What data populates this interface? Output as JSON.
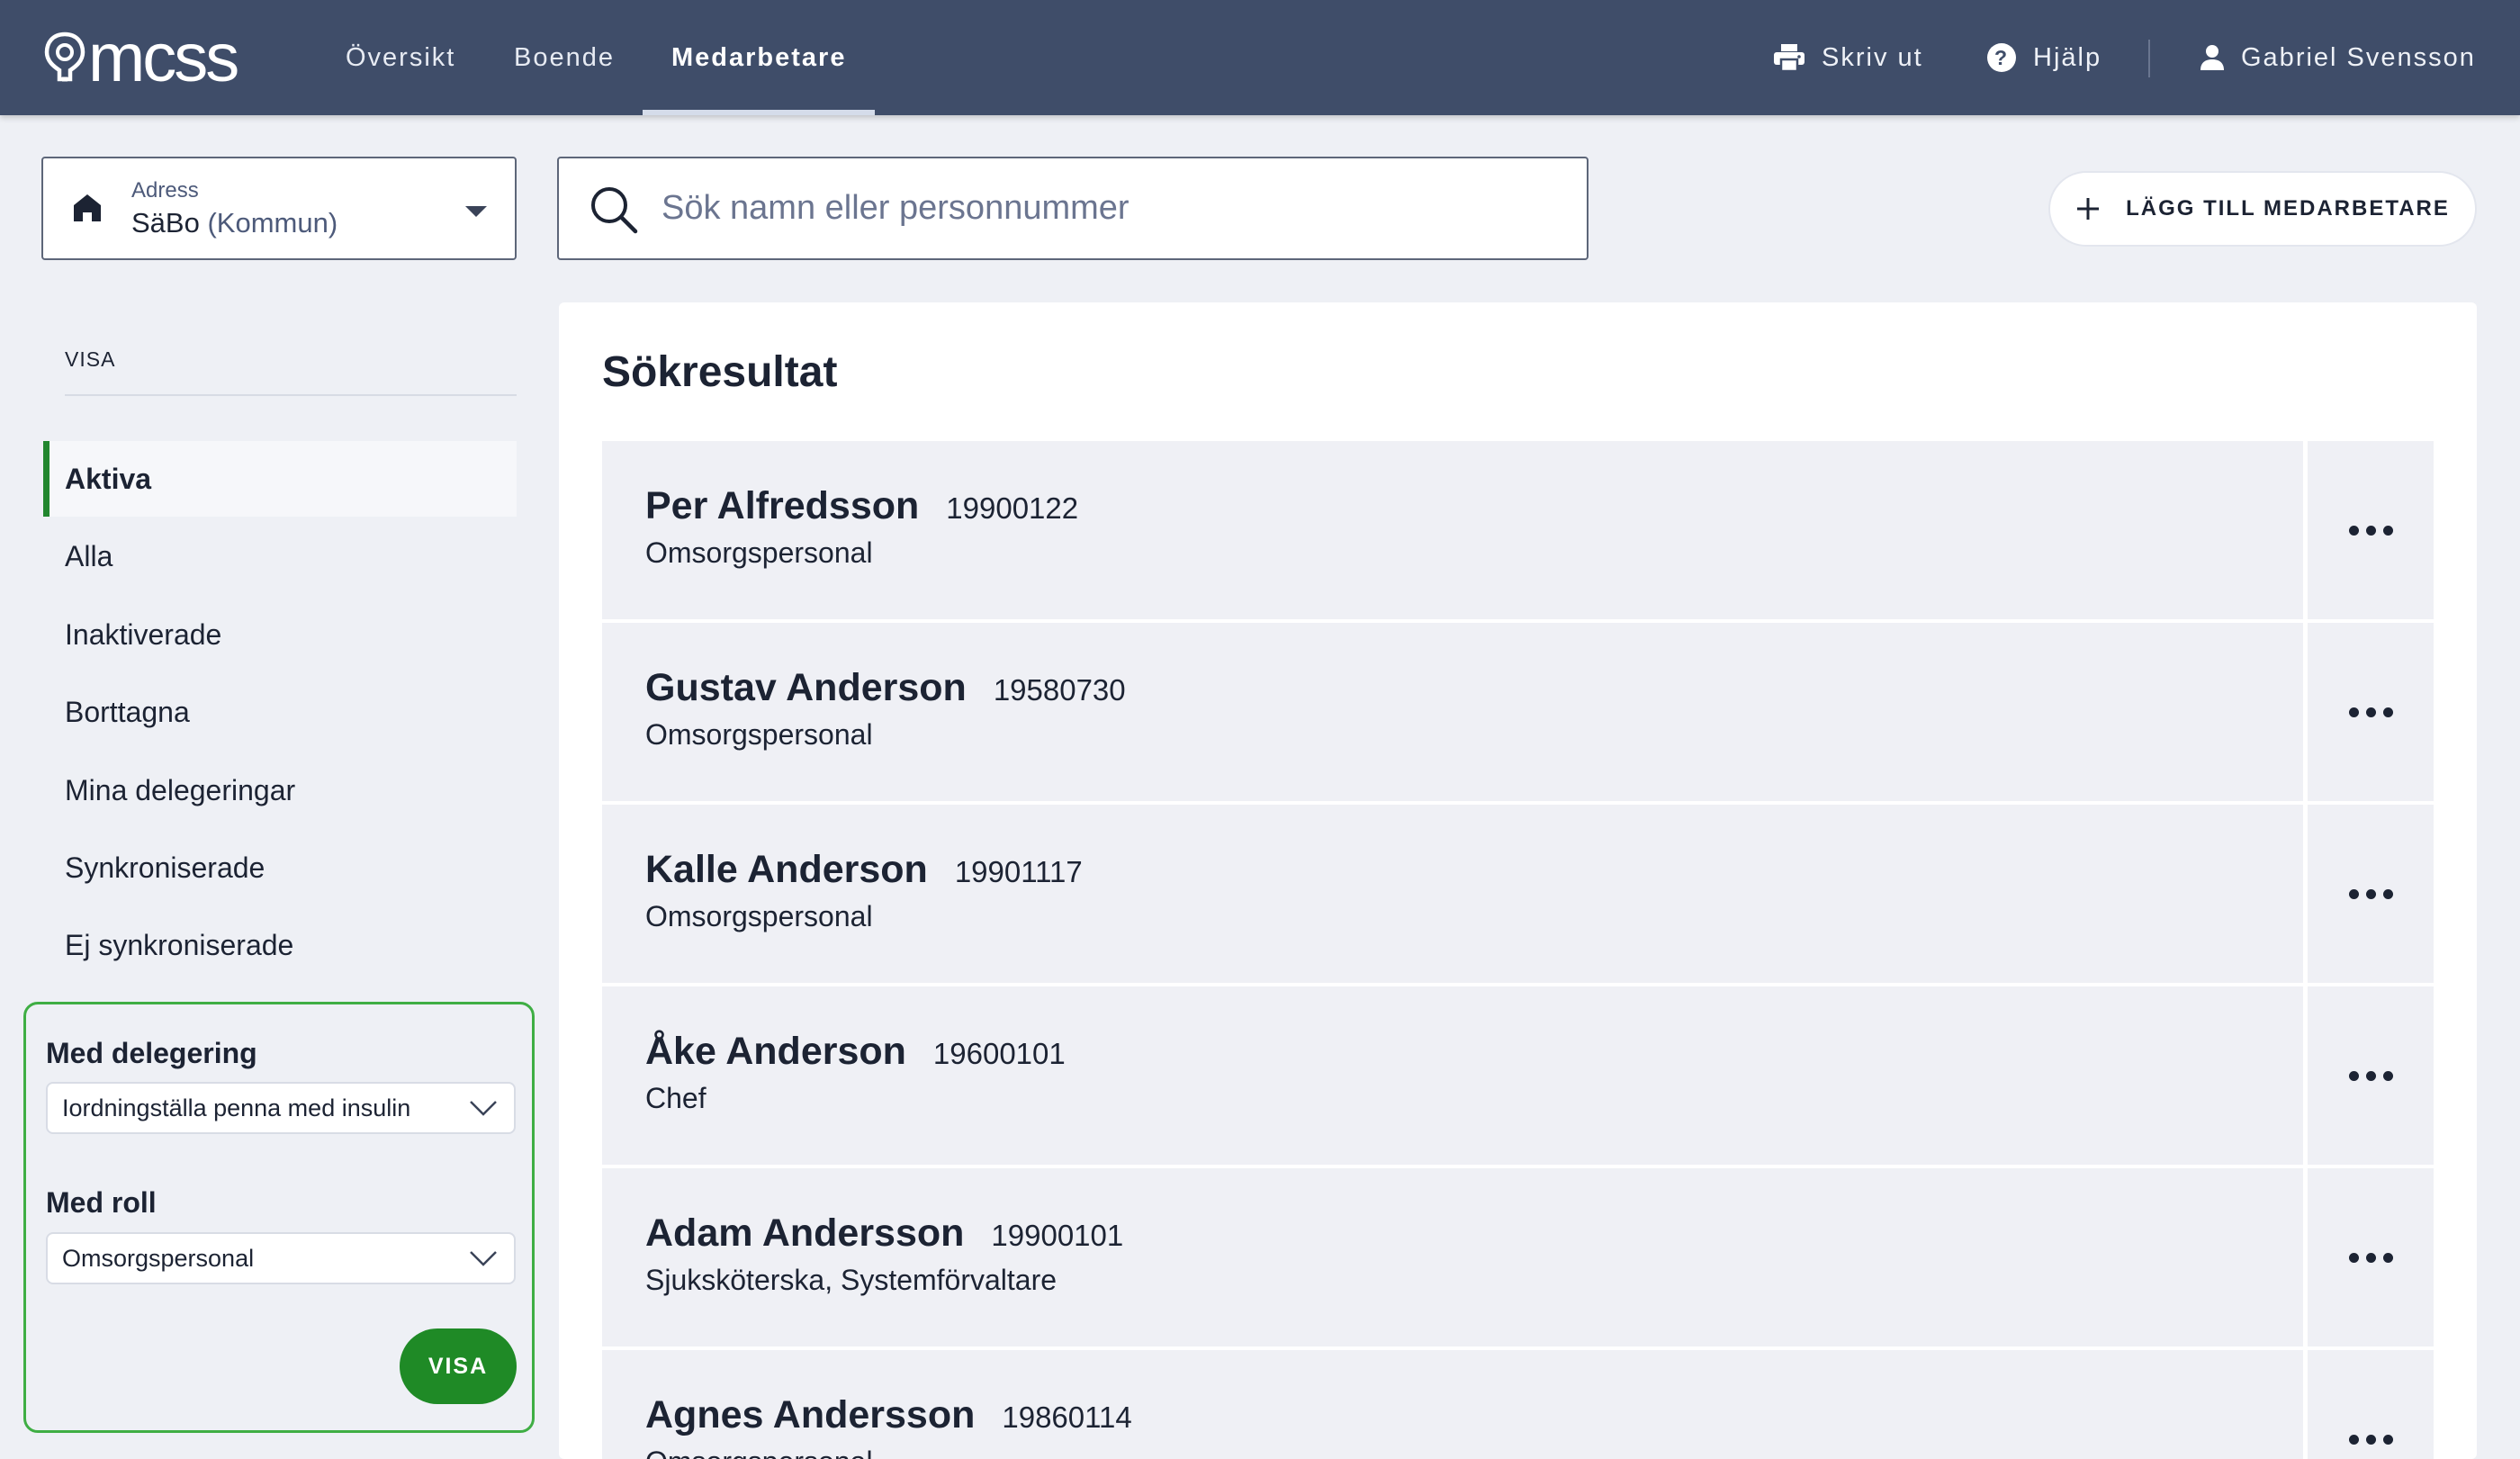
{
  "app": {
    "logo_text": "mcss"
  },
  "nav": {
    "items": [
      {
        "label": "Översikt",
        "active": false
      },
      {
        "label": "Boende",
        "active": false
      },
      {
        "label": "Medarbetare",
        "active": true
      }
    ]
  },
  "topbar_right": {
    "print_label": "Skriv ut",
    "help_label": "Hjälp",
    "user_name": "Gabriel Svensson"
  },
  "address": {
    "label": "Adress",
    "value": "SäBo",
    "qualifier": "(Kommun)"
  },
  "search": {
    "placeholder": "Sök namn eller personnummer"
  },
  "add_button": {
    "label": "LÄGG TILL MEDARBETARE"
  },
  "sidebar": {
    "heading": "VISA",
    "items": [
      {
        "label": "Aktiva",
        "active": true
      },
      {
        "label": "Alla",
        "active": false
      },
      {
        "label": "Inaktiverade",
        "active": false
      },
      {
        "label": "Borttagna",
        "active": false
      },
      {
        "label": "Mina delegeringar",
        "active": false
      },
      {
        "label": "Synkroniserade",
        "active": false
      },
      {
        "label": "Ej synkroniserade",
        "active": false
      }
    ]
  },
  "filter": {
    "delegation_label": "Med delegering",
    "delegation_value": "Iordningställa penna med insulin",
    "role_label": "Med roll",
    "role_value": "Omsorgspersonal",
    "submit_label": "VISA"
  },
  "results": {
    "title": "Sökresultat",
    "rows": [
      {
        "name": "Per Alfredsson",
        "pnr": "19900122",
        "role": "Omsorgspersonal"
      },
      {
        "name": "Gustav Anderson",
        "pnr": "19580730",
        "role": "Omsorgspersonal"
      },
      {
        "name": "Kalle Anderson",
        "pnr": "19901117",
        "role": "Omsorgspersonal"
      },
      {
        "name": "Åke Anderson",
        "pnr": "19600101",
        "role": "Chef"
      },
      {
        "name": "Adam Andersson",
        "pnr": "19900101",
        "role": "Sjuksköterska, Systemförvaltare"
      },
      {
        "name": "Agnes Andersson",
        "pnr": "19860114",
        "role": "Omsorgspersonal"
      }
    ]
  },
  "colors": {
    "topbar": "#3f4d69",
    "accent_green": "#1f8a26",
    "filter_border": "#3fae44",
    "row_bg": "#eff0f5"
  },
  "icons": [
    "logo-mark-icon",
    "printer-icon",
    "help-icon",
    "user-icon",
    "home-icon",
    "caret-down-icon",
    "search-icon",
    "plus-icon",
    "chevron-down-icon",
    "more-icon"
  ]
}
